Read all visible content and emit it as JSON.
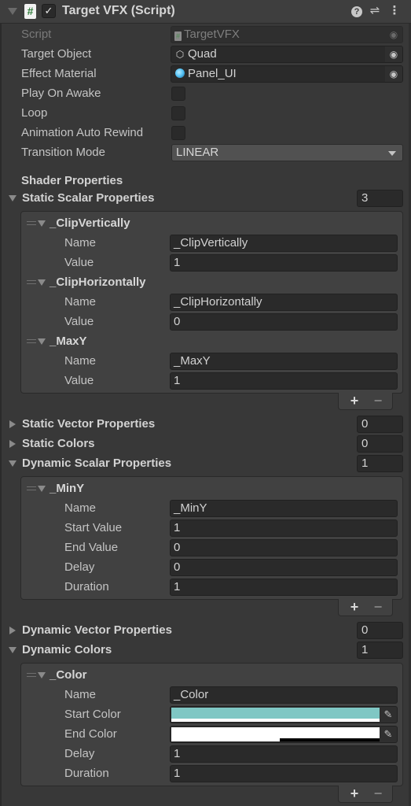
{
  "header": {
    "title": "Target VFX (Script)",
    "enabled": true,
    "icons": [
      "script-icon",
      "help-icon",
      "presets-icon",
      "more-options-icon"
    ]
  },
  "fields": {
    "script": {
      "label": "Script",
      "value": "TargetVFX"
    },
    "target_object": {
      "label": "Target Object",
      "value": "Quad"
    },
    "effect_material": {
      "label": "Effect Material",
      "value": "Panel_UI"
    },
    "play_on_awake": {
      "label": "Play On Awake",
      "checked": false
    },
    "loop": {
      "label": "Loop",
      "checked": false
    },
    "animation_auto_rewind": {
      "label": "Animation Auto Rewind",
      "checked": false
    },
    "transition_mode": {
      "label": "Transition Mode",
      "value": "LINEAR"
    }
  },
  "shader_properties_heading": "Shader Properties",
  "static_scalar": {
    "label": "Static Scalar Properties",
    "count": "3",
    "expanded": true,
    "elements": [
      {
        "title": "_ClipVertically",
        "name_label": "Name",
        "name": "_ClipVertically",
        "value_label": "Value",
        "value": "1"
      },
      {
        "title": "_ClipHorizontally",
        "name_label": "Name",
        "name": "_ClipHorizontally",
        "value_label": "Value",
        "value": "0"
      },
      {
        "title": "_MaxY",
        "name_label": "Name",
        "name": "_MaxY",
        "value_label": "Value",
        "value": "1"
      }
    ]
  },
  "static_vector": {
    "label": "Static Vector Properties",
    "count": "0",
    "expanded": false
  },
  "static_colors": {
    "label": "Static Colors",
    "count": "0",
    "expanded": false
  },
  "dynamic_scalar": {
    "label": "Dynamic Scalar Properties",
    "count": "1",
    "expanded": true,
    "elements": [
      {
        "title": "_MinY",
        "name_label": "Name",
        "name": "_MinY",
        "start_label": "Start Value",
        "start": "1",
        "end_label": "End Value",
        "end": "0",
        "delay_label": "Delay",
        "delay": "0",
        "duration_label": "Duration",
        "duration": "1"
      }
    ]
  },
  "dynamic_vector": {
    "label": "Dynamic Vector Properties",
    "count": "0",
    "expanded": false
  },
  "dynamic_colors": {
    "label": "Dynamic Colors",
    "count": "1",
    "expanded": true,
    "elements": [
      {
        "title": "_Color",
        "name_label": "Name",
        "name": "_Color",
        "start_label": "Start Color",
        "start_color": "#7fc7c4",
        "start_alpha": 1.0,
        "end_label": "End Color",
        "end_color": "#ffffff",
        "end_alpha": 0.52,
        "delay_label": "Delay",
        "delay": "1",
        "duration_label": "Duration",
        "duration": "1"
      }
    ]
  },
  "list_buttons": {
    "add": "+",
    "remove": "−"
  },
  "glyphs": {
    "script": "#",
    "check": "✓",
    "help": "?",
    "presets": "⇌",
    "more": "⋮",
    "picker": "◉",
    "cube": "⬡",
    "eyedropper": "✎"
  }
}
